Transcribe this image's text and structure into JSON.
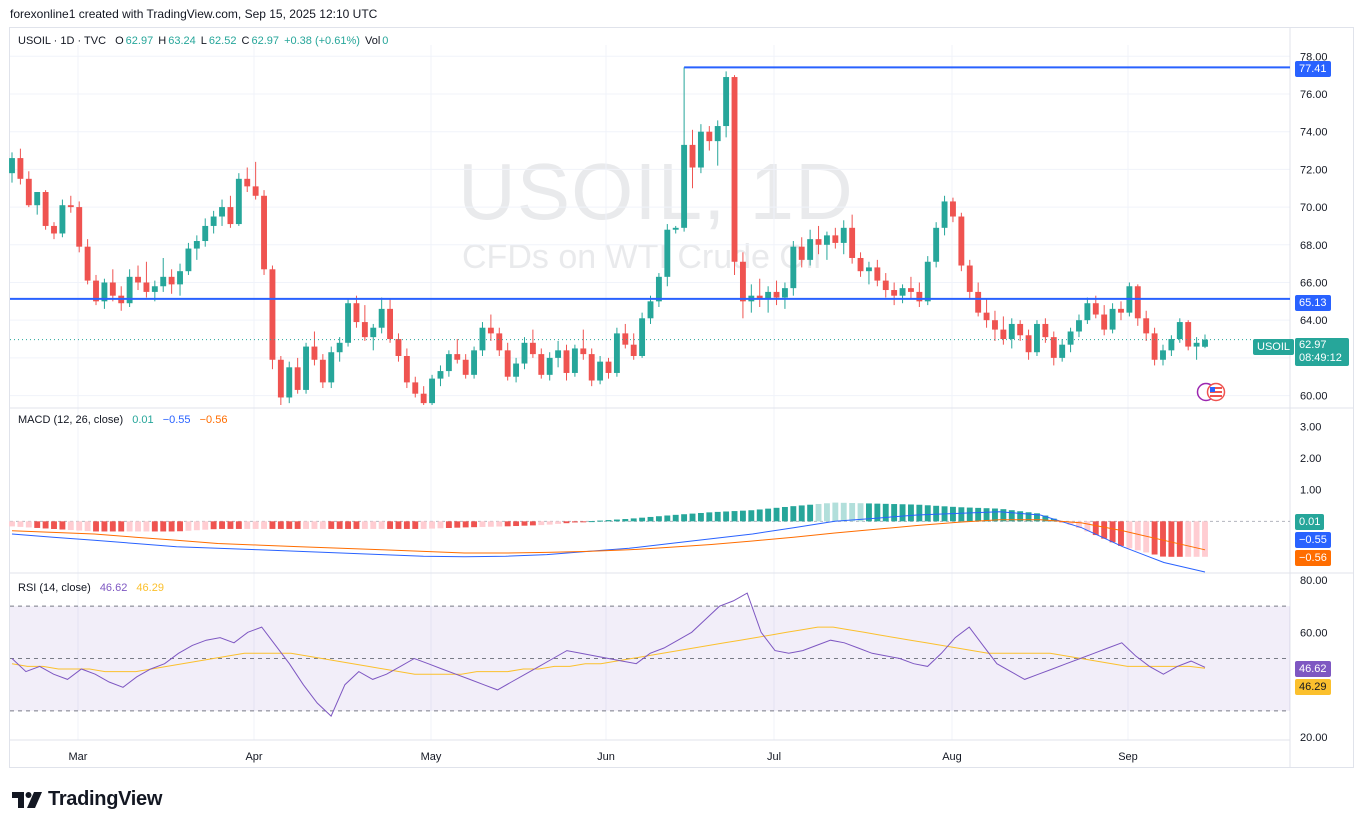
{
  "header": {
    "credit": "forexonline1 created with TradingView.com, Sep 15, 2025 12:10 UTC"
  },
  "legend": {
    "symbol": "USOIL · 1D · TVC",
    "o_label": "O",
    "o": "62.97",
    "h_label": "H",
    "h": "63.24",
    "l_label": "L",
    "l": "62.52",
    "c_label": "C",
    "c": "62.97",
    "change": "+0.38 (+0.61%)",
    "vol_label": "Vol",
    "vol": "0"
  },
  "watermark": {
    "line1": "USOIL, 1D",
    "line2": "CFDs on WTI Crude Oil"
  },
  "macd_legend": {
    "label": "MACD (12, 26, close)",
    "hist": "0.01",
    "macd": "−0.55",
    "signal": "−0.56"
  },
  "rsi_legend": {
    "label": "RSI (14, close)",
    "rsi": "46.62",
    "ma": "46.29"
  },
  "tags": {
    "high_line": "77.41",
    "support_line": "65.13",
    "symbol": "USOIL",
    "last_price": "62.97",
    "countdown": "08:49:12",
    "macd_hist": "0.01",
    "macd": "−0.55",
    "signal": "−0.56",
    "rsi": "46.62",
    "rsi_ma": "46.29"
  },
  "brand": "TradingView",
  "colors": {
    "up": "#26a69a",
    "down": "#ef5350",
    "level_line": "#2962ff",
    "macd_line": "#2962ff",
    "signal_line": "#ff6d00",
    "rsi_line": "#7e57c2",
    "rsi_ma": "#fbc02d"
  },
  "chart_data": [
    {
      "type": "candlestick",
      "title": "USOIL, 1D",
      "y_ticks": [
        "60.00",
        "62.00",
        "64.00",
        "66.00",
        "68.00",
        "70.00",
        "72.00",
        "74.00",
        "76.00",
        "78.00"
      ],
      "ylim": [
        60,
        78.5
      ],
      "x_ticks": [
        "Mar",
        "Apr",
        "May",
        "Jun",
        "Jul",
        "Aug",
        "Sep"
      ],
      "horizontal_levels": [
        77.41,
        65.13
      ],
      "last_price": 62.97,
      "ohlc": [
        [
          71.8,
          72.9,
          71.3,
          72.6
        ],
        [
          72.6,
          73.1,
          71.2,
          71.5
        ],
        [
          71.5,
          71.9,
          70.0,
          70.1
        ],
        [
          70.1,
          70.8,
          69.6,
          70.8
        ],
        [
          70.8,
          70.9,
          68.8,
          69.0
        ],
        [
          69.0,
          69.2,
          68.3,
          68.6
        ],
        [
          68.6,
          70.4,
          68.4,
          70.1
        ],
        [
          70.1,
          70.6,
          69.7,
          70.0
        ],
        [
          70.0,
          70.3,
          67.6,
          67.9
        ],
        [
          67.9,
          68.3,
          65.9,
          66.1
        ],
        [
          66.1,
          66.4,
          64.8,
          65.0
        ],
        [
          65.0,
          66.2,
          64.6,
          66.0
        ],
        [
          66.0,
          66.7,
          65.0,
          65.3
        ],
        [
          65.3,
          65.8,
          64.5,
          64.9
        ],
        [
          64.9,
          66.7,
          64.7,
          66.3
        ],
        [
          66.3,
          66.9,
          65.6,
          66.0
        ],
        [
          66.0,
          67.1,
          65.2,
          65.5
        ],
        [
          65.5,
          66.1,
          65.0,
          65.8
        ],
        [
          65.8,
          67.3,
          65.5,
          66.3
        ],
        [
          66.3,
          66.7,
          65.4,
          65.9
        ],
        [
          65.9,
          67.0,
          65.3,
          66.6
        ],
        [
          66.6,
          68.1,
          66.4,
          67.8
        ],
        [
          67.8,
          68.5,
          67.2,
          68.2
        ],
        [
          68.2,
          69.4,
          67.9,
          69.0
        ],
        [
          69.0,
          69.8,
          68.6,
          69.5
        ],
        [
          69.5,
          70.4,
          69.0,
          70.0
        ],
        [
          70.0,
          70.6,
          68.9,
          69.1
        ],
        [
          69.1,
          71.8,
          69.0,
          71.5
        ],
        [
          71.5,
          72.1,
          70.8,
          71.1
        ],
        [
          71.1,
          72.4,
          70.4,
          70.6
        ],
        [
          70.6,
          70.9,
          66.4,
          66.7
        ],
        [
          66.7,
          66.9,
          61.4,
          61.9
        ],
        [
          61.9,
          62.1,
          59.4,
          59.9
        ],
        [
          59.9,
          61.8,
          59.6,
          61.5
        ],
        [
          61.5,
          62.0,
          60.1,
          60.3
        ],
        [
          60.3,
          62.8,
          60.1,
          62.6
        ],
        [
          62.6,
          63.4,
          61.6,
          61.9
        ],
        [
          61.9,
          62.2,
          60.4,
          60.7
        ],
        [
          60.7,
          62.6,
          60.4,
          62.3
        ],
        [
          62.3,
          63.1,
          61.8,
          62.8
        ],
        [
          62.8,
          65.1,
          62.6,
          64.9
        ],
        [
          64.9,
          65.3,
          63.6,
          63.9
        ],
        [
          63.9,
          64.8,
          62.9,
          63.1
        ],
        [
          63.1,
          63.8,
          62.4,
          63.6
        ],
        [
          63.6,
          65.2,
          63.3,
          64.6
        ],
        [
          64.6,
          65.1,
          62.8,
          63.0
        ],
        [
          63.0,
          63.3,
          61.8,
          62.1
        ],
        [
          62.1,
          62.5,
          60.4,
          60.7
        ],
        [
          60.7,
          61.0,
          59.9,
          60.1
        ],
        [
          60.1,
          60.5,
          59.2,
          59.6
        ],
        [
          59.6,
          61.1,
          59.4,
          60.9
        ],
        [
          60.9,
          61.6,
          60.5,
          61.3
        ],
        [
          61.3,
          62.4,
          61.0,
          62.2
        ],
        [
          62.2,
          63.0,
          61.7,
          61.9
        ],
        [
          61.9,
          62.2,
          60.9,
          61.1
        ],
        [
          61.1,
          62.6,
          60.9,
          62.4
        ],
        [
          62.4,
          63.9,
          62.1,
          63.6
        ],
        [
          63.6,
          64.3,
          62.9,
          63.3
        ],
        [
          63.3,
          63.6,
          62.1,
          62.4
        ],
        [
          62.4,
          62.8,
          60.8,
          61.0
        ],
        [
          61.0,
          62.0,
          60.7,
          61.7
        ],
        [
          61.7,
          63.1,
          61.4,
          62.8
        ],
        [
          62.8,
          63.5,
          62.0,
          62.2
        ],
        [
          62.2,
          62.5,
          60.9,
          61.1
        ],
        [
          61.1,
          62.3,
          60.8,
          62.0
        ],
        [
          62.0,
          62.9,
          61.5,
          62.4
        ],
        [
          62.4,
          62.7,
          60.8,
          61.2
        ],
        [
          61.2,
          62.7,
          61.0,
          62.5
        ],
        [
          62.5,
          63.5,
          61.9,
          62.2
        ],
        [
          62.2,
          62.5,
          60.5,
          60.8
        ],
        [
          60.8,
          62.1,
          60.6,
          61.8
        ],
        [
          61.8,
          62.0,
          60.9,
          61.2
        ],
        [
          61.2,
          63.6,
          61.0,
          63.3
        ],
        [
          63.3,
          63.8,
          62.5,
          62.7
        ],
        [
          62.7,
          63.3,
          61.9,
          62.1
        ],
        [
          62.1,
          64.4,
          62.0,
          64.1
        ],
        [
          64.1,
          65.3,
          63.8,
          65.0
        ],
        [
          65.0,
          66.5,
          64.7,
          66.3
        ],
        [
          66.3,
          69.1,
          65.8,
          68.8
        ],
        [
          68.8,
          69.0,
          68.6,
          68.9
        ],
        [
          68.9,
          77.41,
          68.7,
          73.3
        ],
        [
          73.3,
          74.1,
          71.0,
          72.1
        ],
        [
          72.1,
          74.4,
          71.8,
          74.0
        ],
        [
          74.0,
          74.3,
          73.0,
          73.5
        ],
        [
          73.5,
          74.6,
          72.2,
          74.3
        ],
        [
          74.3,
          77.2,
          73.7,
          76.9
        ],
        [
          76.9,
          77.0,
          66.4,
          67.1
        ],
        [
          67.1,
          67.6,
          64.1,
          65.0
        ],
        [
          65.0,
          65.9,
          64.4,
          65.3
        ],
        [
          65.3,
          66.2,
          64.7,
          65.1
        ],
        [
          65.1,
          65.8,
          64.4,
          65.5
        ],
        [
          65.5,
          66.1,
          64.8,
          65.2
        ],
        [
          65.2,
          66.0,
          64.6,
          65.7
        ],
        [
          65.7,
          68.2,
          65.3,
          67.9
        ],
        [
          67.9,
          68.4,
          66.8,
          67.2
        ],
        [
          67.2,
          68.8,
          66.9,
          68.3
        ],
        [
          68.3,
          69.0,
          67.5,
          68.0
        ],
        [
          68.0,
          68.7,
          67.2,
          68.5
        ],
        [
          68.5,
          68.9,
          67.8,
          68.1
        ],
        [
          68.1,
          69.3,
          67.5,
          68.9
        ],
        [
          68.9,
          69.6,
          67.0,
          67.3
        ],
        [
          67.3,
          67.6,
          66.3,
          66.6
        ],
        [
          66.6,
          67.1,
          65.9,
          66.8
        ],
        [
          66.8,
          67.2,
          65.8,
          66.1
        ],
        [
          66.1,
          66.5,
          65.2,
          65.6
        ],
        [
          65.6,
          66.0,
          64.8,
          65.3
        ],
        [
          65.3,
          65.9,
          64.9,
          65.7
        ],
        [
          65.7,
          66.3,
          65.1,
          65.5
        ],
        [
          65.5,
          66.0,
          64.7,
          65.0
        ],
        [
          65.0,
          67.4,
          64.8,
          67.1
        ],
        [
          67.1,
          69.2,
          66.8,
          68.9
        ],
        [
          68.9,
          70.6,
          68.5,
          70.3
        ],
        [
          70.3,
          70.5,
          69.2,
          69.5
        ],
        [
          69.5,
          69.7,
          66.6,
          66.9
        ],
        [
          66.9,
          67.2,
          65.1,
          65.5
        ],
        [
          65.5,
          66.0,
          64.2,
          64.4
        ],
        [
          64.4,
          65.1,
          63.6,
          64.0
        ],
        [
          64.0,
          64.5,
          62.9,
          63.5
        ],
        [
          63.5,
          64.2,
          62.7,
          63.0
        ],
        [
          63.0,
          64.1,
          62.5,
          63.8
        ],
        [
          63.8,
          64.0,
          62.9,
          63.2
        ],
        [
          63.2,
          63.5,
          61.9,
          62.3
        ],
        [
          62.3,
          64.0,
          62.1,
          63.8
        ],
        [
          63.8,
          64.1,
          62.8,
          63.1
        ],
        [
          63.1,
          63.4,
          61.6,
          62.0
        ],
        [
          62.0,
          63.0,
          61.8,
          62.7
        ],
        [
          62.7,
          63.6,
          62.3,
          63.4
        ],
        [
          63.4,
          64.3,
          63.1,
          64.0
        ],
        [
          64.0,
          65.2,
          63.8,
          64.9
        ],
        [
          64.9,
          65.3,
          64.1,
          64.3
        ],
        [
          64.3,
          64.8,
          63.2,
          63.5
        ],
        [
          63.5,
          64.9,
          63.3,
          64.6
        ],
        [
          64.6,
          65.0,
          64.0,
          64.4
        ],
        [
          64.4,
          66.0,
          64.2,
          65.8
        ],
        [
          65.8,
          65.9,
          63.7,
          64.1
        ],
        [
          64.1,
          64.5,
          62.9,
          63.3
        ],
        [
          63.3,
          63.6,
          61.6,
          61.9
        ],
        [
          61.9,
          62.7,
          61.6,
          62.4
        ],
        [
          62.4,
          63.2,
          62.1,
          63.0
        ],
        [
          63.0,
          64.1,
          62.8,
          63.9
        ],
        [
          63.9,
          64.0,
          62.4,
          62.6
        ],
        [
          62.6,
          63.1,
          61.9,
          62.8
        ],
        [
          62.59,
          63.24,
          62.52,
          62.97
        ]
      ]
    },
    {
      "type": "line",
      "title": "MACD (12, 26, close)",
      "y_ticks": [
        "1.00",
        "2.00",
        "3.00"
      ],
      "ylim": [
        -1.6,
        3.2
      ],
      "series": [
        {
          "name": "MACD",
          "values": [
            -0.4,
            -0.5,
            -0.6,
            -0.7,
            -0.8,
            -0.85,
            -0.9,
            -0.95,
            -1.0,
            -1.05,
            -1.1,
            -1.12,
            -1.1,
            -1.05,
            -0.95,
            -0.85,
            -0.7,
            -0.55,
            -0.4,
            -0.2,
            0.0,
            0.1,
            0.2,
            0.25,
            0.3,
            0.2,
            -0.2,
            -0.8,
            -1.3,
            -1.6
          ]
        },
        {
          "name": "Signal",
          "values": [
            -0.3,
            -0.35,
            -0.4,
            -0.5,
            -0.6,
            -0.7,
            -0.75,
            -0.8,
            -0.85,
            -0.9,
            -0.95,
            -1.0,
            -1.0,
            -0.98,
            -0.95,
            -0.9,
            -0.82,
            -0.73,
            -0.62,
            -0.5,
            -0.37,
            -0.25,
            -0.13,
            -0.03,
            0.05,
            0.05,
            -0.05,
            -0.3,
            -0.6,
            -0.9
          ]
        },
        {
          "name": "Histogram",
          "values": [
            0.01
          ]
        }
      ]
    },
    {
      "type": "line",
      "title": "RSI (14, close)",
      "y_ticks": [
        "20.00",
        "60.00",
        "80.00"
      ],
      "ylim": [
        20,
        80
      ],
      "bands": [
        70,
        50,
        30
      ],
      "series": [
        {
          "name": "RSI",
          "values": [
            50,
            45,
            47,
            44,
            42,
            46,
            44,
            41,
            39,
            43,
            46,
            48,
            52,
            55,
            57,
            58,
            56,
            60,
            62,
            55,
            48,
            40,
            33,
            28,
            40,
            45,
            42,
            44,
            47,
            50,
            48,
            46,
            44,
            42,
            40,
            38,
            41,
            44,
            47,
            50,
            53,
            52,
            51,
            50,
            49,
            48,
            52,
            54,
            57,
            60,
            65,
            70,
            72,
            75,
            60,
            53,
            52,
            53,
            55,
            57,
            56,
            54,
            52,
            51,
            50,
            48,
            47,
            52,
            58,
            62,
            55,
            48,
            45,
            42,
            44,
            46,
            48,
            50,
            52,
            54,
            56,
            51,
            47,
            44,
            47,
            49,
            46.62
          ]
        },
        {
          "name": "RSI MA",
          "values": [
            48,
            47,
            47,
            46,
            46,
            46,
            45,
            45,
            45,
            46,
            47,
            48,
            49,
            50,
            51,
            52,
            52,
            52,
            52,
            51,
            50,
            49,
            48,
            47,
            46,
            45,
            44,
            44,
            44,
            44,
            45,
            45,
            45,
            46,
            46,
            47,
            47,
            48,
            48,
            49,
            50,
            51,
            52,
            53,
            54,
            55,
            56,
            57,
            58,
            59,
            60,
            61,
            62,
            62,
            61,
            60,
            59,
            58,
            57,
            56,
            55,
            54,
            53,
            52,
            52,
            52,
            52,
            52,
            51,
            50,
            49,
            48,
            47,
            47,
            47,
            47,
            47,
            46.29
          ]
        }
      ]
    }
  ]
}
